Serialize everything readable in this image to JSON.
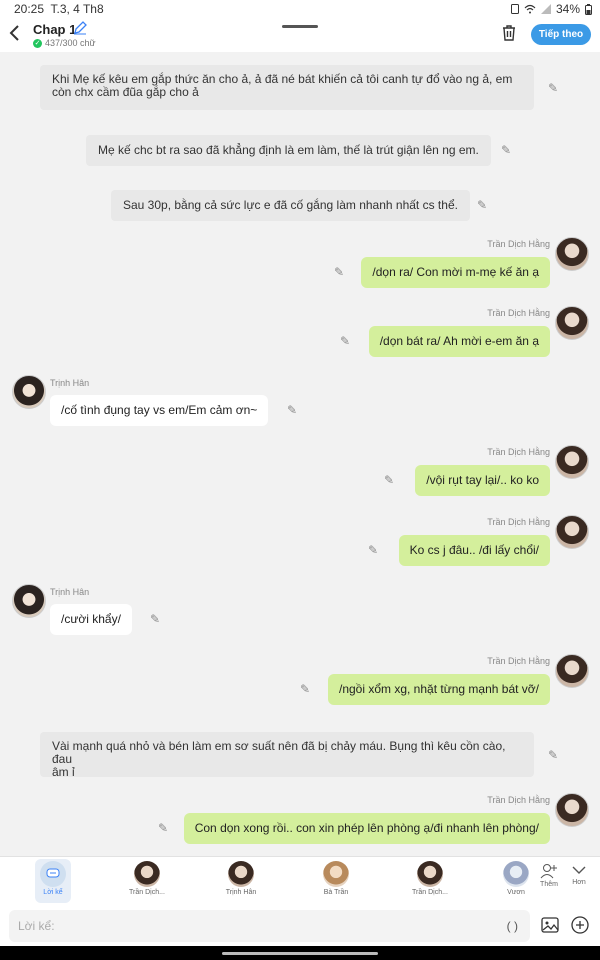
{
  "status": {
    "time": "20:25",
    "date": "T.3, 4 Th8",
    "battery": "34%"
  },
  "header": {
    "title": "Chap 1",
    "counter": "437/300 chữ",
    "follow_label": "Tiếp theo"
  },
  "messages": {
    "n1": {
      "line1": "Khi Mẹ kế kêu em gắp thức ăn cho ả, ả đã né bát khiến cả tôi canh tự đổ vào ng ả, em",
      "line2": "còn chx cầm đũa gắp cho ả"
    },
    "n2": {
      "text": "Mẹ kế chc bt ra sao đã khẳng định là em làm, thế là trút giận lên ng em."
    },
    "n3": {
      "text": "Sau 30p, bằng cả sức lực e đã cố gắng làm nhanh nhất cs thể."
    },
    "r1": {
      "name": "Trần Dịch Hằng",
      "text": "/dọn ra/ Con mời m-mẹ kế ăn ạ"
    },
    "r2": {
      "name": "Trần Dịch Hằng",
      "text": "/dọn bát ra/ Ah mời e-em ăn ạ"
    },
    "l1": {
      "name": "Trịnh Hân",
      "text": "/cố tình đụng tay vs em/Em cảm ơn~"
    },
    "r3": {
      "name": "Trần Dịch Hằng",
      "text": "/vội rụt tay lại/.. ko ko"
    },
    "r4": {
      "name": "Trần Dịch Hằng",
      "text": "Ko cs j đâu.. /đi lấy chổi/"
    },
    "l2": {
      "name": "Trịnh Hân",
      "text": "/cười khẩy/"
    },
    "r5": {
      "name": "Trần Dịch Hằng",
      "text": "/ngồi xổm xg, nhặt từng mạnh bát vỡ/"
    },
    "n4": {
      "line1": "Vài mạnh quá nhỏ và bén làm em sơ suất nên đã bị chảy máu. Bụng thì kêu cồn cào, đau",
      "line2": "âm ỉ"
    },
    "r6": {
      "name": "Trần Dịch Hằng",
      "text": "Con dọn xong rồi.. con xin phép lên phòng ạ/đi nhanh lên phòng/"
    }
  },
  "characters": {
    "narrator": "Lời kể",
    "c1": "Trần Dịch...",
    "c2": "Trịnh Hân",
    "c3": "Bà Trần",
    "c4": "Trần Dịch...",
    "c5": "Vươn",
    "add_label": "Thêm",
    "more_label": "Hơn"
  },
  "input": {
    "placeholder": "Lời kể:",
    "paren": "( )"
  },
  "colors": {
    "accent": "#3b9ae6",
    "bubble_self": "#d4ef9c",
    "narration_bg": "#e8e8e8"
  }
}
